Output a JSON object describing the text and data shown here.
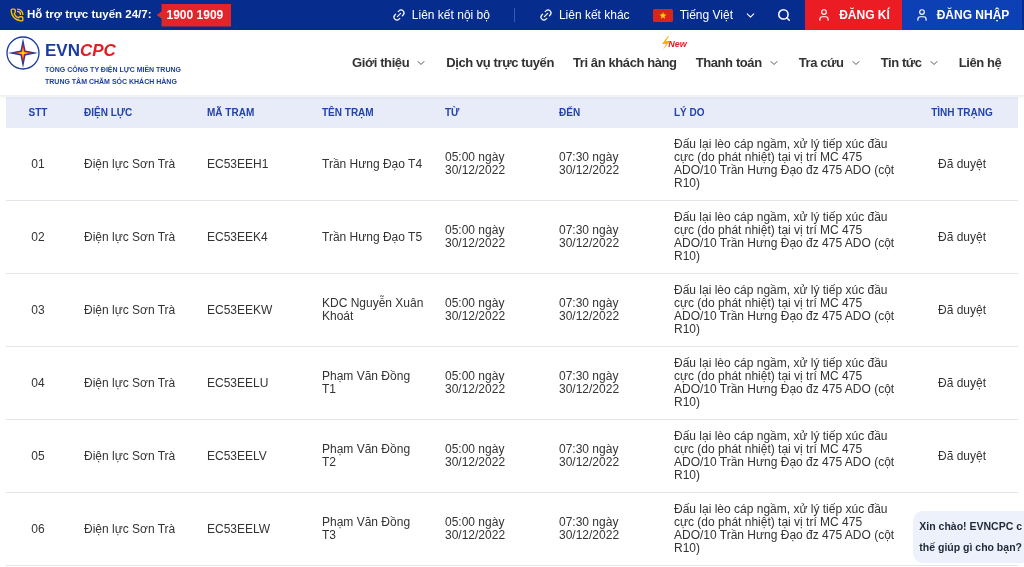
{
  "top_bar": {
    "hotline_label": "Hỗ trợ trực tuyến 24/7:",
    "hotline_number": "1900 1909",
    "links": [
      {
        "label": "Liên kết nội bộ"
      },
      {
        "label": "Liên kết khác"
      }
    ],
    "language": "Tiếng Việt",
    "auth_buttons": [
      {
        "kind": "register",
        "label": "ĐĂNG KÍ"
      },
      {
        "kind": "login",
        "label": "ĐĂNG NHẬP"
      }
    ]
  },
  "header": {
    "logo": {
      "wordmark_first": "EVN",
      "wordmark_second": "CPC",
      "subtitle_lines": [
        "TỔNG CÔNG TY ĐIỆN LỰC MIỀN TRUNG",
        "TRUNG TÂM CHĂM SÓC KHÁCH HÀNG"
      ]
    },
    "nav": [
      {
        "label": "Giới thiệu",
        "has_dropdown": true
      },
      {
        "label": "Dịch vụ trực tuyến",
        "has_dropdown": false
      },
      {
        "label": "Tri ân khách hàng",
        "has_dropdown": false,
        "badge": "New"
      },
      {
        "label": "Thanh toán",
        "has_dropdown": true
      },
      {
        "label": "Tra cứu",
        "has_dropdown": true
      },
      {
        "label": "Tin tức",
        "has_dropdown": true
      },
      {
        "label": "Liên hệ",
        "has_dropdown": false
      }
    ]
  },
  "table": {
    "columns": [
      {
        "label": "STT"
      },
      {
        "label": "ĐIỆN LỰC"
      },
      {
        "label": "MÃ TRẠM"
      },
      {
        "label": "TÊN TRẠM"
      },
      {
        "label": "TỪ"
      },
      {
        "label": "ĐẾN"
      },
      {
        "label": "LÝ DO"
      },
      {
        "label": "TÌNH TRẠNG"
      }
    ],
    "rows": [
      {
        "stt": "01",
        "unit": "Điện lực Sơn Trà",
        "station_code": "EC53EEH1",
        "station_name": "Trần Hưng Đạo T4",
        "from": "05:00 ngày 30/12/2022",
        "to": "07:30 ngày 30/12/2022",
        "reason": "Đấu lại lèo cáp ngầm, xử lý tiếp xúc đầu cực (do phát nhiệt) tại vị trí MC 475 ADO/10 Trần Hưng Đạo đz 475 ADO (cột R10)",
        "status": "Đã duyệt"
      },
      {
        "stt": "02",
        "unit": "Điện lực Sơn Trà",
        "station_code": "EC53EEK4",
        "station_name": "Trần Hưng Đạo T5",
        "from": "05:00 ngày 30/12/2022",
        "to": "07:30 ngày 30/12/2022",
        "reason": "Đấu lại lèo cáp ngầm, xử lý tiếp xúc đầu cực (do phát nhiệt) tại vị trí MC 475 ADO/10 Trần Hưng Đạo đz 475 ADO (cột R10)",
        "status": "Đã duyệt"
      },
      {
        "stt": "03",
        "unit": "Điện lực Sơn Trà",
        "station_code": "EC53EEKW",
        "station_name": "KDC Nguyễn Xuân Khoát",
        "from": "05:00 ngày 30/12/2022",
        "to": "07:30 ngày 30/12/2022",
        "reason": "Đấu lại lèo cáp ngầm, xử lý tiếp xúc đầu cực (do phát nhiệt) tại vị trí MC 475 ADO/10 Trần Hưng Đạo đz 475 ADO (cột R10)",
        "status": "Đã duyệt"
      },
      {
        "stt": "04",
        "unit": "Điện lực Sơn Trà",
        "station_code": "EC53EELU",
        "station_name": "Phạm Văn Đồng T1",
        "from": "05:00 ngày 30/12/2022",
        "to": "07:30 ngày 30/12/2022",
        "reason": "Đấu lại lèo cáp ngầm, xử lý tiếp xúc đầu cực (do phát nhiệt) tại vị trí MC 475 ADO/10 Trần Hưng Đạo đz 475 ADO (cột R10)",
        "status": "Đã duyệt"
      },
      {
        "stt": "05",
        "unit": "Điện lực Sơn Trà",
        "station_code": "EC53EELV",
        "station_name": "Phạm Văn Đồng T2",
        "from": "05:00 ngày 30/12/2022",
        "to": "07:30 ngày 30/12/2022",
        "reason": "Đấu lại lèo cáp ngầm, xử lý tiếp xúc đầu cực (do phát nhiệt) tại vị trí MC 475 ADO/10 Trần Hưng Đạo đz 475 ADO (cột R10)",
        "status": "Đã duyệt"
      },
      {
        "stt": "06",
        "unit": "Điện lực Sơn Trà",
        "station_code": "EC53EELW",
        "station_name": "Phạm Văn Đồng T3",
        "from": "05:00 ngày 30/12/2022",
        "to": "07:30 ngày 30/12/2022",
        "reason": "Đấu lại lèo cáp ngầm, xử lý tiếp xúc đầu cực (do phát nhiệt) tại vị trí MC 475 ADO/10 Trần Hưng Đạo đz 475 ADO (cột R10)"
      }
    ]
  },
  "chat_bubble": {
    "lines": [
      "Xin chào! EVNCPC c",
      "thế giúp gì cho bạn?"
    ]
  }
}
